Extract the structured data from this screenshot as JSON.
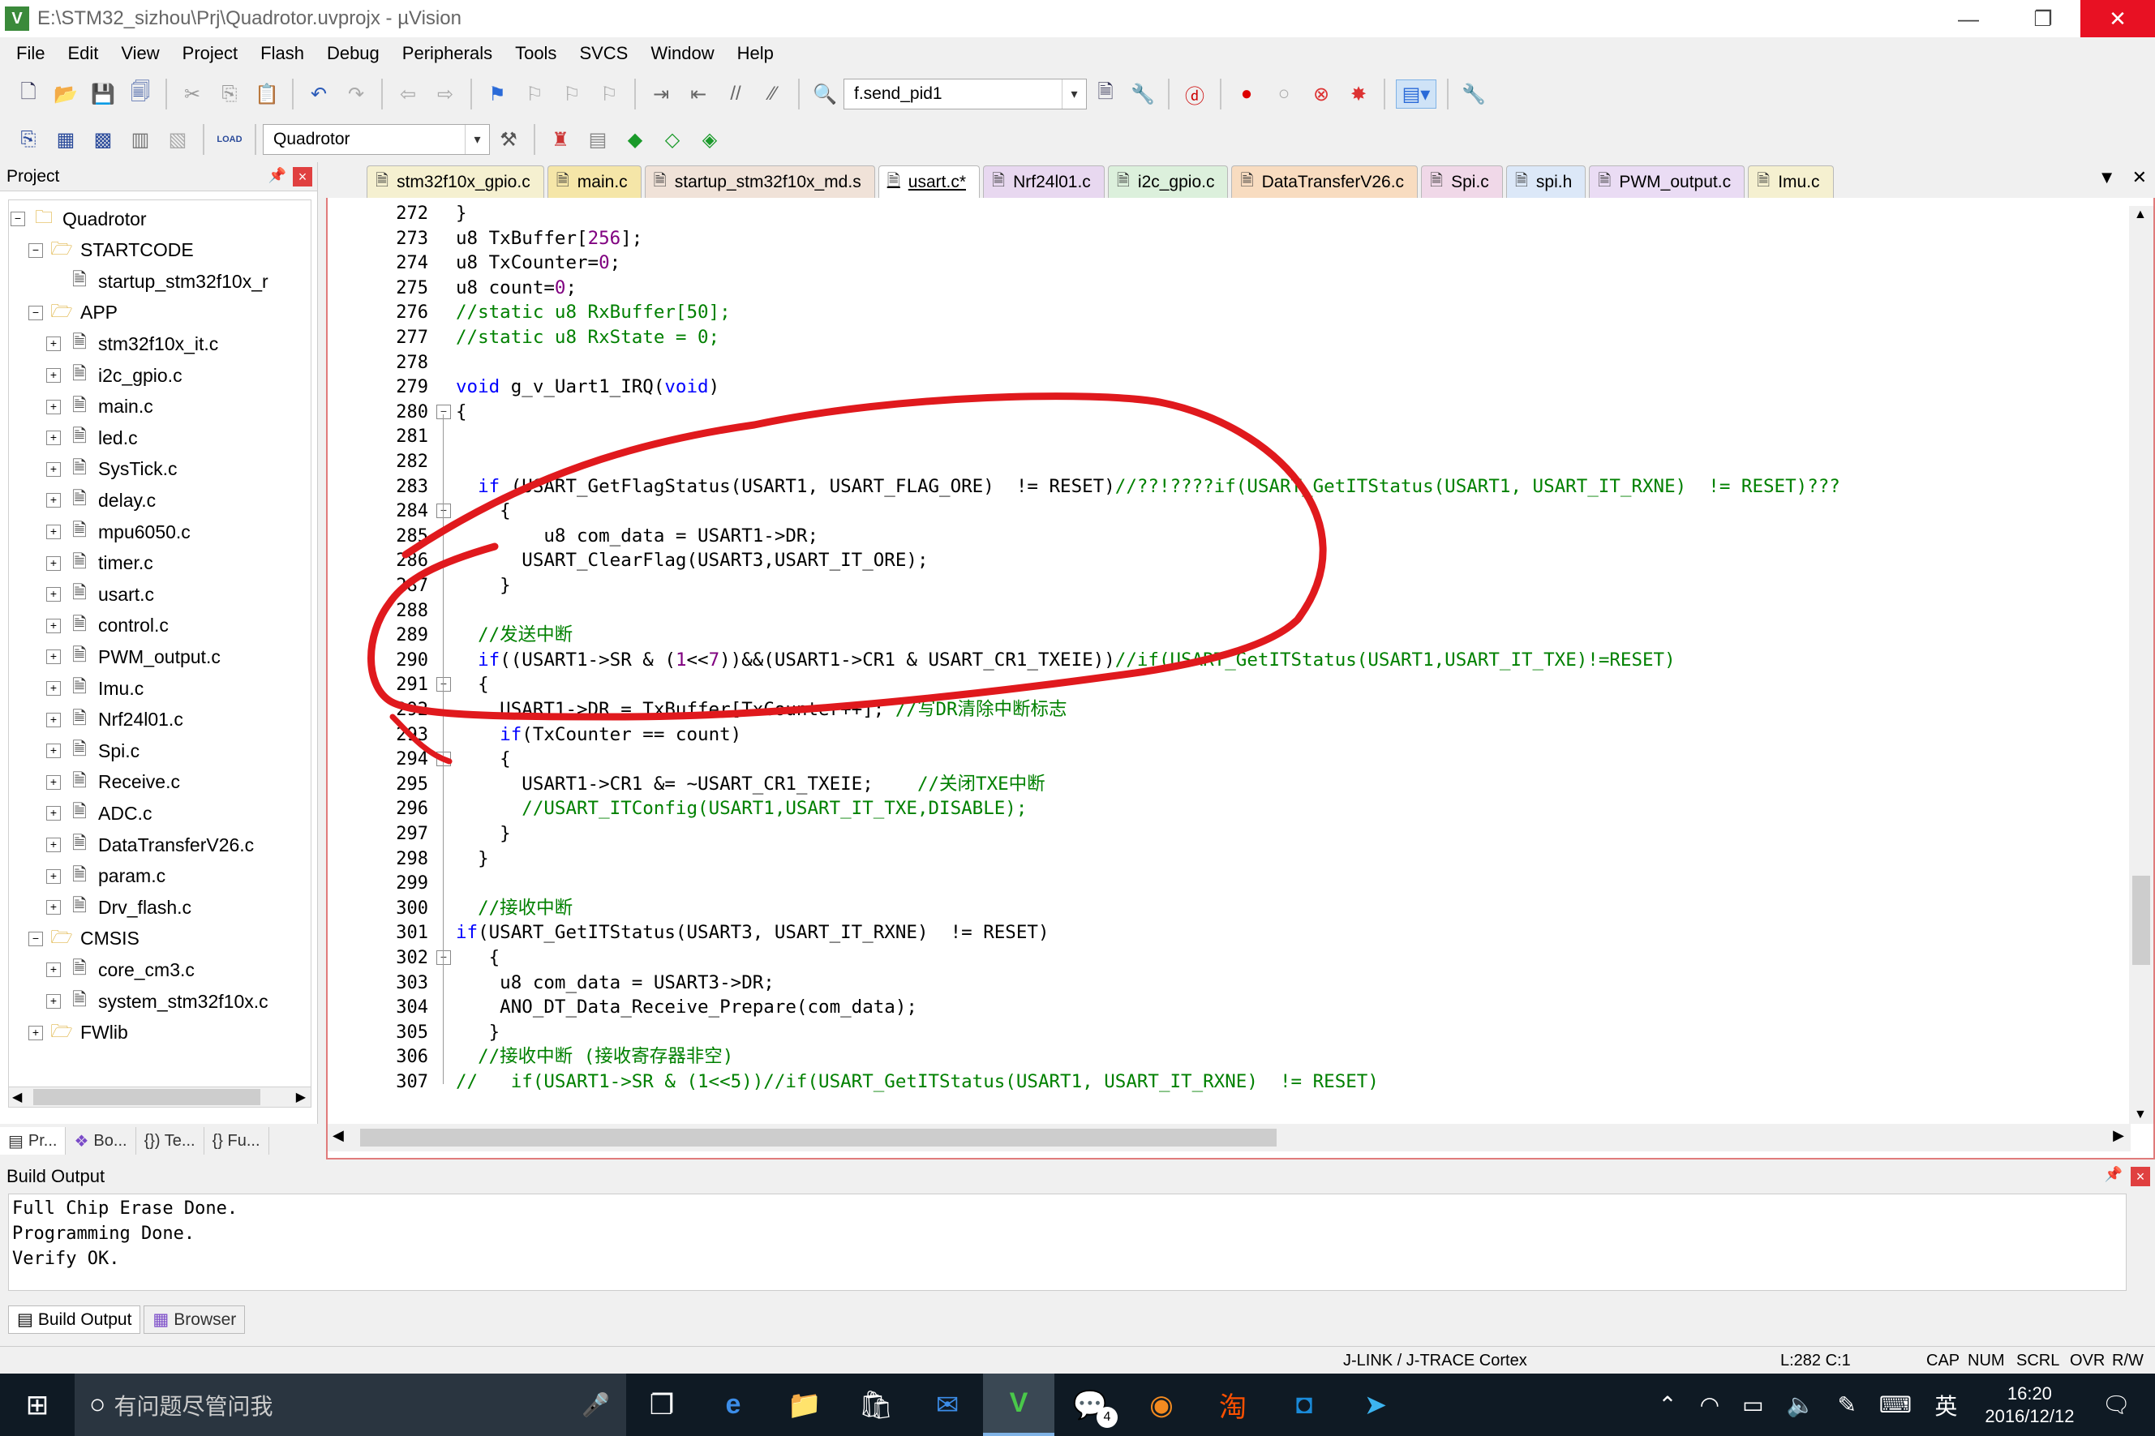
{
  "window": {
    "title": "E:\\STM32_sizhou\\Prj\\Quadrotor.uvprojx - µVision",
    "app_icon_letter": "V",
    "min_glyph": "—",
    "max_glyph": "❐",
    "close_glyph": "✕"
  },
  "menu": [
    "File",
    "Edit",
    "View",
    "Project",
    "Flash",
    "Debug",
    "Peripherals",
    "Tools",
    "SVCS",
    "Window",
    "Help"
  ],
  "toolbar1": {
    "find_combo_value": "f.send_pid1"
  },
  "toolbar2": {
    "target_combo_value": "Quadrotor",
    "load_label": "LOAD"
  },
  "project_panel": {
    "title": "Project",
    "tree": [
      {
        "label": "Quadrotor",
        "level": 0,
        "type": "root",
        "exp": "⊟"
      },
      {
        "label": "STARTCODE",
        "level": 1,
        "type": "folder",
        "exp": "⊟"
      },
      {
        "label": "startup_stm32f10x_r",
        "level": 2,
        "type": "file",
        "exp": ""
      },
      {
        "label": "APP",
        "level": 1,
        "type": "folder",
        "exp": "⊟"
      },
      {
        "label": "stm32f10x_it.c",
        "level": 2,
        "type": "file",
        "exp": "⊞"
      },
      {
        "label": "i2c_gpio.c",
        "level": 2,
        "type": "file",
        "exp": "⊞"
      },
      {
        "label": "main.c",
        "level": 2,
        "type": "file",
        "exp": "⊞"
      },
      {
        "label": "led.c",
        "level": 2,
        "type": "file",
        "exp": "⊞"
      },
      {
        "label": "SysTick.c",
        "level": 2,
        "type": "file",
        "exp": "⊞"
      },
      {
        "label": "delay.c",
        "level": 2,
        "type": "file",
        "exp": "⊞"
      },
      {
        "label": "mpu6050.c",
        "level": 2,
        "type": "file",
        "exp": "⊞"
      },
      {
        "label": "timer.c",
        "level": 2,
        "type": "file",
        "exp": "⊞"
      },
      {
        "label": "usart.c",
        "level": 2,
        "type": "file",
        "exp": "⊞"
      },
      {
        "label": "control.c",
        "level": 2,
        "type": "file",
        "exp": "⊞"
      },
      {
        "label": "PWM_output.c",
        "level": 2,
        "type": "file",
        "exp": "⊞"
      },
      {
        "label": "Imu.c",
        "level": 2,
        "type": "file",
        "exp": "⊞"
      },
      {
        "label": "Nrf24l01.c",
        "level": 2,
        "type": "file",
        "exp": "⊞"
      },
      {
        "label": "Spi.c",
        "level": 2,
        "type": "file",
        "exp": "⊞"
      },
      {
        "label": "Receive.c",
        "level": 2,
        "type": "file",
        "exp": "⊞"
      },
      {
        "label": "ADC.c",
        "level": 2,
        "type": "file",
        "exp": "⊞"
      },
      {
        "label": "DataTransferV26.c",
        "level": 2,
        "type": "file",
        "exp": "⊞"
      },
      {
        "label": "param.c",
        "level": 2,
        "type": "file",
        "exp": "⊞"
      },
      {
        "label": "Drv_flash.c",
        "level": 2,
        "type": "file",
        "exp": "⊞"
      },
      {
        "label": "CMSIS",
        "level": 1,
        "type": "folder",
        "exp": "⊟"
      },
      {
        "label": "core_cm3.c",
        "level": 2,
        "type": "file",
        "exp": "⊞"
      },
      {
        "label": "system_stm32f10x.c",
        "level": 2,
        "type": "file",
        "exp": "⊞"
      },
      {
        "label": "FWlib",
        "level": 1,
        "type": "folder",
        "exp": "⊞"
      }
    ],
    "bottom_tabs": [
      "Pr...",
      "Bo...",
      "{}) Te...",
      "{} Fu..."
    ]
  },
  "editor_tabs": [
    {
      "label": "stm32f10x_gpio.c",
      "color": "#f5f0d0",
      "active": false
    },
    {
      "label": "main.c",
      "color": "#f5e6a8",
      "active": false
    },
    {
      "label": "startup_stm32f10x_md.s",
      "color": "#f0e2d8",
      "active": false
    },
    {
      "label": "usart.c*",
      "color": "#ffffff",
      "active": true
    },
    {
      "label": "Nrf24l01.c",
      "color": "#e8d8f0",
      "active": false
    },
    {
      "label": "i2c_gpio.c",
      "color": "#dcf0dc",
      "active": false
    },
    {
      "label": "DataTransferV26.c",
      "color": "#f8dcc0",
      "active": false
    },
    {
      "label": "Spi.c",
      "color": "#f0d8e8",
      "active": false
    },
    {
      "label": "spi.h",
      "color": "#dce8f8",
      "active": false
    },
    {
      "label": "PWM_output.c",
      "color": "#eadcf4",
      "active": false
    },
    {
      "label": "Imu.c",
      "color": "#f5f0d0",
      "active": false
    }
  ],
  "editor": {
    "lines": [
      {
        "n": "272",
        "fold": "",
        "code": "}",
        "html": "}"
      },
      {
        "n": "273",
        "fold": "",
        "code": "u8 TxBuffer[256];",
        "html": "u8 TxBuffer[<span class=\"num\">256</span>];"
      },
      {
        "n": "274",
        "fold": "",
        "code": "u8 TxCounter=0;",
        "html": "u8 TxCounter=<span class=\"num\">0</span>;"
      },
      {
        "n": "275",
        "fold": "",
        "code": "u8 count=0;",
        "html": "u8 count=<span class=\"num\">0</span>;"
      },
      {
        "n": "276",
        "fold": "",
        "code": "//static u8 RxBuffer[50];",
        "html": "<span class=\"cm\">//static u8 RxBuffer[50];</span>"
      },
      {
        "n": "277",
        "fold": "",
        "code": "//static u8 RxState = 0;",
        "html": "<span class=\"cm\">//static u8 RxState = 0;</span>"
      },
      {
        "n": "278",
        "fold": "",
        "code": "",
        "html": ""
      },
      {
        "n": "279",
        "fold": "",
        "code": "void g_v_Uart1_IRQ(void)",
        "html": "<span class=\"kw\">void</span> g_v_Uart1_IRQ(<span class=\"kw\">void</span>)"
      },
      {
        "n": "280",
        "fold": "⊟",
        "code": "{",
        "html": "{"
      },
      {
        "n": "281",
        "fold": "",
        "code": "",
        "html": ""
      },
      {
        "n": "282",
        "fold": "",
        "code": "",
        "html": ""
      },
      {
        "n": "283",
        "fold": "",
        "code": "  if (USART_GetFlagStatus(USART1, USART_FLAG_ORE)  != RESET)//??!????if(USART_GetITStatus(USART1, USART_IT_RXNE)  != RESET)???",
        "html": "  <span class=\"kw\">if</span> (USART_GetFlagStatus(USART1, USART_FLAG_ORE)  != RESET)<span class=\"cm\">//??!????if(USART_GetITStatus(USART1, USART_IT_RXNE)  != RESET)???</span>"
      },
      {
        "n": "284",
        "fold": "⊟",
        "code": "    {",
        "html": "    {"
      },
      {
        "n": "285",
        "fold": "",
        "code": "        u8 com_data = USART1->DR;",
        "html": "        u8 com_data = USART1-&gt;DR;"
      },
      {
        "n": "286",
        "fold": "",
        "code": "      USART_ClearFlag(USART3,USART_IT_ORE);",
        "html": "      USART_ClearFlag(USART3,USART_IT_ORE);"
      },
      {
        "n": "287",
        "fold": "",
        "code": "    }",
        "html": "    }"
      },
      {
        "n": "288",
        "fold": "",
        "code": "",
        "html": ""
      },
      {
        "n": "289",
        "fold": "",
        "code": "  //发送中断",
        "html": "  <span class=\"cm\">//发送中断</span>"
      },
      {
        "n": "290",
        "fold": "",
        "code": "  if((USART1->SR & (1<<7))&&(USART1->CR1 & USART_CR1_TXEIE))//if(USART_GetITStatus(USART1,USART_IT_TXE)!=RESET)",
        "html": "  <span class=\"kw\">if</span>((USART1-&gt;SR &amp; (<span class=\"num\">1</span>&lt;&lt;<span class=\"num\">7</span>))&amp;&amp;(USART1-&gt;CR1 &amp; USART_CR1_TXEIE))<span class=\"cm\">//if(USART_GetITStatus(USART1,USART_IT_TXE)!=RESET)</span>"
      },
      {
        "n": "291",
        "fold": "⊟",
        "code": "  {",
        "html": "  {"
      },
      {
        "n": "292",
        "fold": "",
        "code": "    USART1->DR = TxBuffer[TxCounter++]; //写DR清除中断标志",
        "html": "    USART1-&gt;DR = TxBuffer[TxCounter++]; <span class=\"cm\">//写DR清除中断标志</span>"
      },
      {
        "n": "293",
        "fold": "",
        "code": "    if(TxCounter == count)",
        "html": "    <span class=\"kw\">if</span>(TxCounter == count)"
      },
      {
        "n": "294",
        "fold": "⊟",
        "code": "    {",
        "html": "    {"
      },
      {
        "n": "295",
        "fold": "",
        "code": "      USART1->CR1 &= ~USART_CR1_TXEIE;    //关闭TXE中断",
        "html": "      USART1-&gt;CR1 &amp;= ~USART_CR1_TXEIE;    <span class=\"cm\">//关闭TXE中断</span>"
      },
      {
        "n": "296",
        "fold": "",
        "code": "      //USART_ITConfig(USART1,USART_IT_TXE,DISABLE);",
        "html": "      <span class=\"cm\">//USART_ITConfig(USART1,USART_IT_TXE,DISABLE);</span>"
      },
      {
        "n": "297",
        "fold": "",
        "code": "    }",
        "html": "    }"
      },
      {
        "n": "298",
        "fold": "",
        "code": "  }",
        "html": "  }"
      },
      {
        "n": "299",
        "fold": "",
        "code": "",
        "html": ""
      },
      {
        "n": "300",
        "fold": "",
        "code": "  //接收中断",
        "html": "  <span class=\"cm\">//接收中断</span>"
      },
      {
        "n": "301",
        "fold": "",
        "code": "if(USART_GetITStatus(USART3, USART_IT_RXNE)  != RESET)",
        "html": "<span class=\"kw\">if</span>(USART_GetITStatus(USART3, USART_IT_RXNE)  != RESET)"
      },
      {
        "n": "302",
        "fold": "⊟",
        "code": "   {",
        "html": "   {"
      },
      {
        "n": "303",
        "fold": "",
        "code": "    u8 com_data = USART3->DR;",
        "html": "    u8 com_data = USART3-&gt;DR;"
      },
      {
        "n": "304",
        "fold": "",
        "code": "    ANO_DT_Data_Receive_Prepare(com_data);",
        "html": "    ANO_DT_Data_Receive_Prepare(com_data);"
      },
      {
        "n": "305",
        "fold": "",
        "code": "   }",
        "html": "   }"
      },
      {
        "n": "306",
        "fold": "",
        "code": "  //接收中断 (接收寄存器非空)",
        "html": "  <span class=\"cm\">//接收中断 (接收寄存器非空)</span>"
      },
      {
        "n": "307",
        "fold": "",
        "code": "//   if(USART1->SR & (1<<5))//if(USART_GetITStatus(USART1, USART_IT_RXNE)  != RESET)",
        "html": "<span class=\"cm\">//   if(USART1-&gt;SR &amp; (1&lt;&lt;5))//if(USART_GetITStatus(USART1, USART_IT_RXNE)  != RESET)</span>"
      }
    ]
  },
  "build_output": {
    "title": "Build Output",
    "text": "Full Chip Erase Done.\nProgramming Done.\nVerify OK.",
    "tabs": [
      "Build Output",
      "Browser"
    ]
  },
  "status": {
    "debugger": "J-LINK / J-TRACE Cortex",
    "position": "L:282 C:1",
    "caps": "CAP",
    "num": "NUM",
    "scrl": "SCRL",
    "ovr": "OVR",
    "rw": "R/W"
  },
  "taskbar": {
    "search_placeholder": "有问题尽管问我",
    "badge_count": "4",
    "ime": "英",
    "time": "16:20",
    "date": "2016/12/12"
  },
  "colors": {
    "annotation_red": "#e0191d",
    "editor_border": "#e07b7b",
    "comment_green": "#008000",
    "keyword_blue": "#0000ff"
  }
}
